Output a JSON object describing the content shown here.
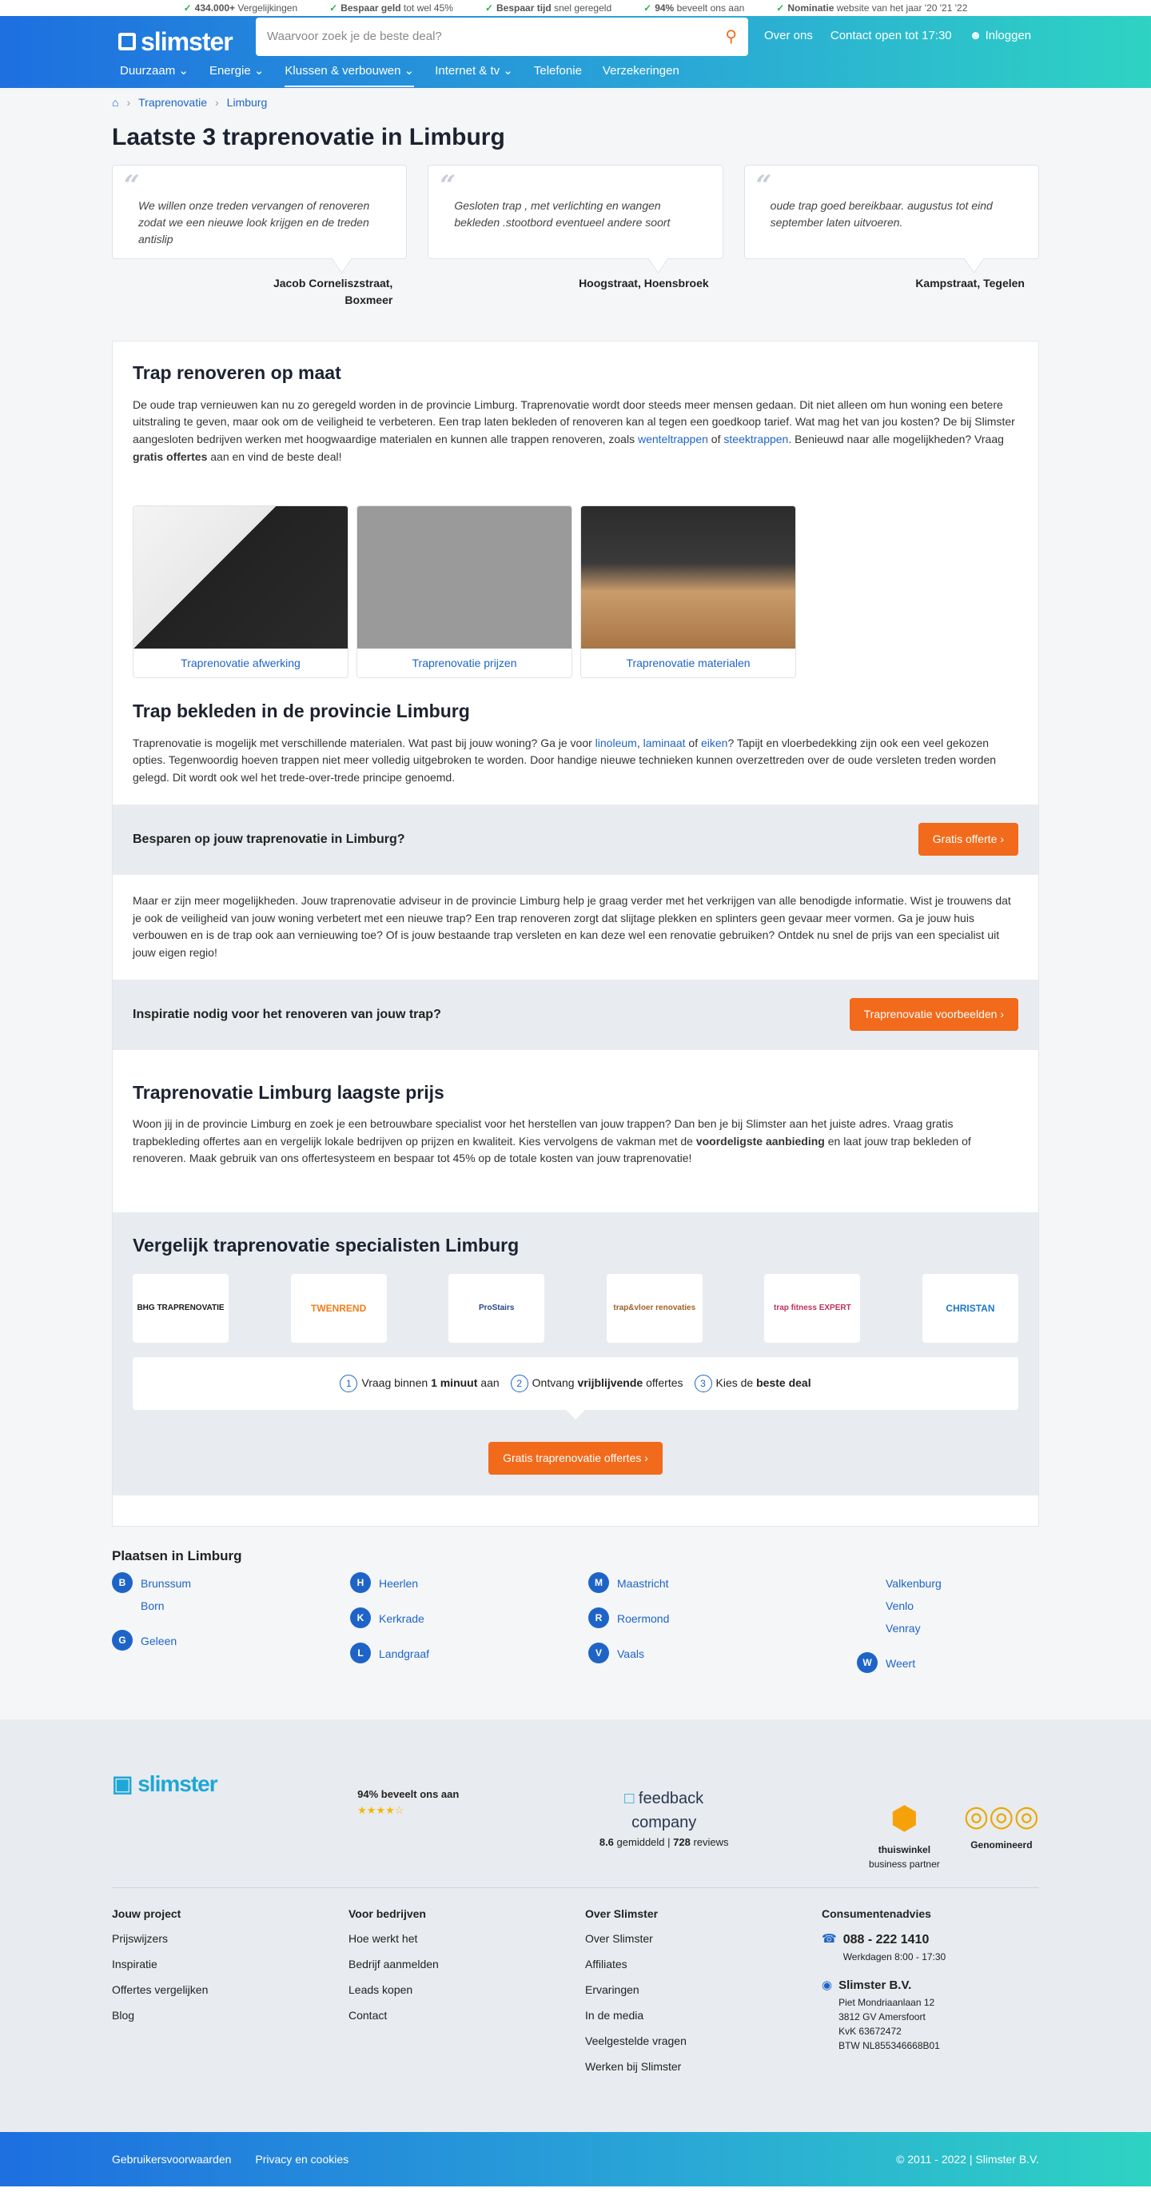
{
  "topbar": [
    {
      "bold": "434.000+",
      "text": "Vergelijkingen"
    },
    {
      "bold": "Bespaar geld",
      "text": "tot wel 45%"
    },
    {
      "bold": "Bespaar tijd",
      "text": "snel geregeld"
    },
    {
      "bold": "94%",
      "text": "beveelt ons aan"
    },
    {
      "bold": "Nominatie",
      "text": "website van het jaar '20 '21 '22"
    }
  ],
  "header": {
    "logo": "slimster",
    "search_placeholder": "Waarvoor zoek je de beste deal?",
    "over_ons": "Over ons",
    "contact": "Contact open tot 17:30",
    "login": "Inloggen"
  },
  "nav": [
    "Duurzaam",
    "Energie",
    "Klussen & verbouwen",
    "Internet & tv",
    "Telefonie",
    "Verzekeringen"
  ],
  "breadcrumb": [
    "Traprenovatie",
    "Limburg"
  ],
  "title": "Laatste 3 traprenovatie in Limburg",
  "reviews": [
    {
      "text": "We willen onze treden vervangen of renoveren zodat we een nieuwe look krijgen en de treden antislip",
      "author": "Jacob Corneliszstraat, Boxmeer"
    },
    {
      "text": "Gesloten trap , met verlichting en wangen bekleden .stootbord eventueel andere soort",
      "author": "Hoogstraat, Hoensbroek"
    },
    {
      "text": "oude trap goed bereikbaar. augustus tot eind september laten uitvoeren.",
      "author": "Kampstraat, Tegelen"
    }
  ],
  "sec1": {
    "title": "Trap renoveren op maat",
    "p1": "De oude trap vernieuwen kan nu zo geregeld worden in de provincie Limburg. Traprenovatie wordt door steeds meer mensen gedaan. Dit niet alleen om hun woning een betere uitstraling te geven, maar ook om de veiligheid te verbeteren. Een trap laten bekleden of renoveren kan al tegen een goedkoop tarief. Wat mag het van jou kosten? De bij Slimster aangesloten bedrijven werken met hoogwaardige materialen en kunnen alle trappen renoveren, zoals ",
    "link1": "wenteltrappen",
    "of": " of ",
    "link2": "steektrappen",
    "p1b": ". Benieuwd naar alle mogelijkheden? Vraag ",
    "bold": "gratis offertes",
    "p1c": " aan en vind de beste deal!"
  },
  "images": [
    "Traprenovatie afwerking",
    "Traprenovatie prijzen",
    "Traprenovatie materialen"
  ],
  "sec2": {
    "title": "Trap bekleden in de provincie Limburg",
    "a": "Traprenovatie is mogelijk met verschillende materialen. Wat past bij jouw woning? Ga je voor ",
    "l1": "linoleum",
    "c1": ", ",
    "l2": "laminaat",
    "c2": " of ",
    "l3": "eiken",
    "b": "? Tapijt en vloerbedekking zijn ook een veel gekozen opties. Tegenwoordig hoeven trappen niet meer volledig uitgebroken te worden. Door handige nieuwe technieken kunnen overzettreden over de oude versleten treden worden gelegd. Dit wordt ook wel het trede-over-trede principe genoemd."
  },
  "band1": {
    "text": "Besparen op jouw traprenovatie in Limburg?",
    "btn": "Gratis offerte"
  },
  "sec3": "Maar er zijn meer mogelijkheden. Jouw traprenovatie adviseur in de provincie Limburg help je graag verder met het verkrijgen van alle benodigde informatie. Wist je trouwens dat je ook de veiligheid van jouw woning verbetert met een nieuwe trap? Een trap renoveren zorgt dat slijtage plekken en splinters geen gevaar meer vormen. Ga je jouw huis verbouwen en is de trap ook aan vernieuwing toe? Of is jouw bestaande trap versleten en kan deze wel een renovatie gebruiken? Ontdek nu snel de prijs van een specialist uit jouw eigen regio!",
  "band2": {
    "text": "Inspiratie nodig voor het renoveren van jouw trap?",
    "btn": "Traprenovatie voorbeelden"
  },
  "sec4": {
    "title": "Traprenovatie Limburg laagste prijs",
    "a": "Woon jij in de provincie Limburg en zoek je een betrouwbare specialist voor het herstellen van jouw trappen? Dan ben je bij Slimster aan het juiste adres. Vraag gratis trapbekleding offertes aan en vergelijk lokale bedrijven op prijzen en kwaliteit. Kies vervolgens de vakman met de ",
    "bold": "voordeligste aanbieding",
    "b": " en laat jouw trap bekleden of renoveren. Maak gebruik van ons offertesysteem en bespaar tot 45% op de totale kosten van jouw traprenovatie!"
  },
  "compare": {
    "title": "Vergelijk traprenovatie specialisten Limburg",
    "logos": [
      "BHG TRAPRENOVATIE",
      "TWENREND",
      "ProStairs",
      "trap&vloer renovaties",
      "trap fitness EXPERT",
      "CHRISTAN"
    ],
    "steps": [
      {
        "n": "1",
        "a": "Vraag binnen ",
        "b": "1 minuut",
        "c": " aan"
      },
      {
        "n": "2",
        "a": "Ontvang ",
        "b": "vrijblijvende",
        "c": " offertes"
      },
      {
        "n": "3",
        "a": "Kies de ",
        "b": "beste deal",
        "c": ""
      }
    ],
    "btn": "Gratis traprenovatie offertes"
  },
  "places": {
    "title": "Plaatsen in Limburg",
    "cols": [
      [
        {
          "letter": "B",
          "names": [
            "Brunssum",
            "Born"
          ]
        },
        {
          "letter": "G",
          "names": [
            "Geleen"
          ]
        }
      ],
      [
        {
          "letter": "H",
          "names": [
            "Heerlen"
          ]
        },
        {
          "letter": "K",
          "names": [
            "Kerkrade"
          ]
        },
        {
          "letter": "L",
          "names": [
            "Landgraaf"
          ]
        }
      ],
      [
        {
          "letter": "M",
          "names": [
            "Maastricht"
          ]
        },
        {
          "letter": "R",
          "names": [
            "Roermond"
          ]
        },
        {
          "letter": "V",
          "names": [
            "Vaals"
          ]
        }
      ],
      [
        {
          "letter": "",
          "names": [
            "Valkenburg",
            "Venlo",
            "Venray"
          ]
        },
        {
          "letter": "W",
          "names": [
            "Weert"
          ]
        }
      ]
    ]
  },
  "footer": {
    "logo": "slimster",
    "recommend": "94% beveelt ons aan",
    "feedback1": "feedback",
    "feedback2": "company",
    "score": "8.6",
    "score_text": " gemiddeld | ",
    "reviews": "728",
    "reviews_text": " reviews",
    "thuiswinkel": "thuiswinkel",
    "partner": "business partner",
    "genom": "Genomineerd",
    "cols": [
      {
        "h": "Jouw project",
        "items": [
          "Prijswijzers",
          "Inspiratie",
          "Offertes vergelijken",
          "Blog"
        ]
      },
      {
        "h": "Voor bedrijven",
        "items": [
          "Hoe werkt het",
          "Bedrijf aanmelden",
          "Leads kopen",
          "Contact"
        ]
      },
      {
        "h": "Over Slimster",
        "items": [
          "Over Slimster",
          "Affiliates",
          "Ervaringen",
          "In de media",
          "Veelgestelde vragen",
          "Werken bij Slimster"
        ]
      }
    ],
    "consumer": {
      "h": "Consumentenadvies",
      "phone": "088 - 222 1410",
      "hours": "Werkdagen 8:00 - 17:30",
      "company": "Slimster B.V.",
      "addr": [
        "Piet Mondriaanlaan 12",
        "3812 GV Amersfoort",
        "KvK 63672472",
        "BTW NL855346668B01"
      ]
    },
    "bottom": {
      "terms": "Gebruikersvoorwaarden",
      "privacy": "Privacy en cookies",
      "copy": "© 2011 - 2022 | Slimster B.V."
    }
  }
}
